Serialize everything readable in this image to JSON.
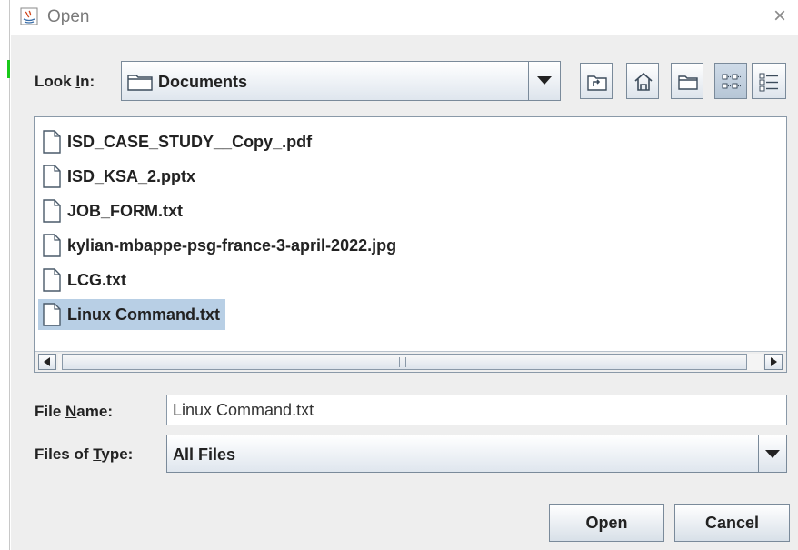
{
  "window": {
    "title": "Open",
    "close_glyph": "×"
  },
  "look_in": {
    "label_prefix": "Look ",
    "label_mnemonic": "I",
    "label_suffix": "n:",
    "value": "Documents"
  },
  "toolbar": {
    "buttons": [
      {
        "icon": "up-one-level-icon"
      },
      {
        "icon": "home-icon"
      },
      {
        "icon": "new-folder-icon"
      },
      {
        "icon": "list-view-icon",
        "selected": true
      },
      {
        "icon": "details-view-icon"
      }
    ]
  },
  "files": [
    {
      "name": "ISD_CASE_STUDY__Copy_.pdf",
      "selected": false
    },
    {
      "name": "ISD_KSA_2.pptx",
      "selected": false
    },
    {
      "name": "JOB_FORM.txt",
      "selected": false
    },
    {
      "name": "kylian-mbappe-psg-france-3-april-2022.jpg",
      "selected": false
    },
    {
      "name": "LCG.txt",
      "selected": false
    },
    {
      "name": "Linux Command.txt",
      "selected": true
    }
  ],
  "file_name": {
    "label_prefix": "File ",
    "label_mnemonic": "N",
    "label_suffix": "ame:",
    "value": "Linux Command.txt"
  },
  "file_type": {
    "label_prefix": "Files of ",
    "label_mnemonic": "T",
    "label_suffix": "ype:",
    "value": "All Files"
  },
  "buttons": {
    "open": "Open",
    "cancel": "Cancel"
  },
  "colors": {
    "selection": "#b8cfe5",
    "panel": "#eeeeee",
    "accent_mark": "#19c919"
  }
}
